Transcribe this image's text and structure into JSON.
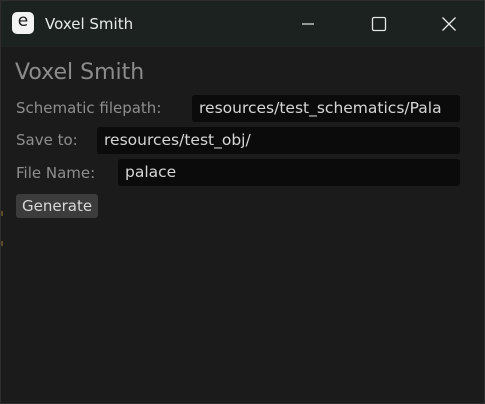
{
  "window": {
    "title": "Voxel Smith",
    "icon_letter": "e",
    "controls": {
      "minimize": "minimize-icon",
      "maximize": "maximize-icon",
      "close": "close-icon"
    }
  },
  "app": {
    "heading": "Voxel Smith",
    "fields": {
      "schematic": {
        "label": "Schematic filepath:",
        "value": "resources/test_schematics/Pala"
      },
      "save_to": {
        "label": "Save to:",
        "value": "resources/test_obj/"
      },
      "file_name": {
        "label": "File Name:",
        "value": "palace"
      }
    },
    "generate_label": "Generate"
  },
  "colors": {
    "titlebar": "#1b2220",
    "background": "#1b1b1b",
    "input_bg": "#0b0b0b",
    "button_bg": "#3c3c3c",
    "label_text": "#8e8e8e",
    "input_text": "#d6d6d6"
  }
}
